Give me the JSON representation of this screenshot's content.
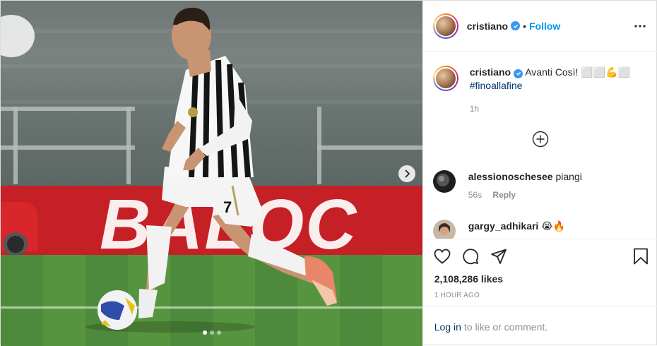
{
  "post": {
    "author": {
      "username": "cristiano",
      "verified": true,
      "follow_label": "Follow",
      "separator": "•"
    },
    "media": {
      "board_text": "BALOC",
      "jersey_number": "7",
      "carousel": {
        "slide_count": 3,
        "active_index": 0
      }
    },
    "caption": {
      "username": "cristiano",
      "text": "Avanti Così! ⬜⬜💪⬜",
      "hashtag": "#finoallafine",
      "time": "1h"
    },
    "comments": [
      {
        "username": "alessionoschesee",
        "text": "piangi",
        "time": "56s",
        "reply_label": "Reply"
      },
      {
        "username": "gargy_adhikari",
        "text": "😭🔥",
        "time": "",
        "reply_label": ""
      }
    ],
    "likes": "2,108,286 likes",
    "posted_ago": "1 HOUR AGO",
    "login": {
      "link": "Log in",
      "rest": "to like or comment."
    }
  },
  "colors": {
    "accent": "#0095f6",
    "verified": "#3897f0",
    "hashtag": "#00376b",
    "muted": "#8e8e8e",
    "board_red": "#c52026"
  },
  "icons": {
    "like": "heart-outline",
    "comment": "speech-bubble",
    "share": "paper-plane",
    "save": "bookmark",
    "more": "three-dots",
    "load_more": "plus-circle",
    "carousel_next": "chevron-right"
  }
}
